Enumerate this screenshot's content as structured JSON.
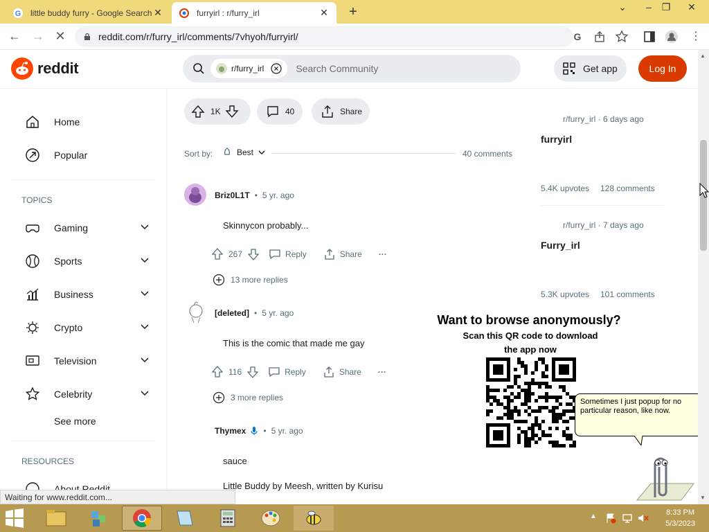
{
  "browser": {
    "tabs": [
      {
        "title": "little buddy furry - Google Search",
        "active": false
      },
      {
        "title": "furry⁡irl : r/furry_irl",
        "active": true
      }
    ],
    "url": "reddit.com/r/furry_irl/comments/7vhyoh/furryirl/",
    "status": "Waiting for www.reddit.com..."
  },
  "header": {
    "logo": "reddit",
    "community_chip": "r/furry_irl",
    "search_placeholder": "Search Community",
    "get_app": "Get app",
    "login": "Log In"
  },
  "sidebar": {
    "home": "Home",
    "popular": "Popular",
    "topics_heading": "TOPICS",
    "topics": [
      "Gaming",
      "Sports",
      "Business",
      "Crypto",
      "Television",
      "Celebrity"
    ],
    "see_more": "See more",
    "resources_heading": "RESOURCES",
    "about": "About Reddit"
  },
  "post": {
    "votes": "1K",
    "comments": "40",
    "share": "Share"
  },
  "sort": {
    "label": "Sort by:",
    "value": "Best",
    "count": "40 comments"
  },
  "comments": [
    {
      "author": "Briz0L1T",
      "age": "5 yr. ago",
      "body": "Skinnycon probably...",
      "votes": "267",
      "reply": "Reply",
      "share": "Share",
      "more": "13 more replies"
    },
    {
      "author": "[deleted]",
      "age": "5 yr. ago",
      "body": "This is the comic that made me gay",
      "votes": "116",
      "reply": "Reply",
      "share": "Share",
      "more": "3 more replies"
    },
    {
      "author": "Thymex",
      "age": "5 yr. ago",
      "body": "sauce",
      "body2": "Little Buddy by Meesh, written by Kurisu"
    }
  ],
  "related": [
    {
      "meta": "r/furry_irl · 6 days ago",
      "title": "furry⁡irl",
      "upvotes": "5.4K upvotes",
      "comments": "128 comments"
    },
    {
      "meta": "r/furry_irl · 7 days ago",
      "title": "Furry_irl",
      "upvotes": "5.3K upvotes",
      "comments": "101 comments"
    }
  ],
  "overlay": {
    "title": "Want to browse anonymously?",
    "subtitle": "Scan this QR code to download the app now",
    "clippy_text": "Sometimes I just popup for no particular reason, like now."
  },
  "taskbar": {
    "time": "8:33 PM",
    "date": "5/3/2023"
  },
  "colors": {
    "accent": "#d93a00",
    "taskbar": "#b79a51",
    "tabstrip": "#f0d97a"
  }
}
